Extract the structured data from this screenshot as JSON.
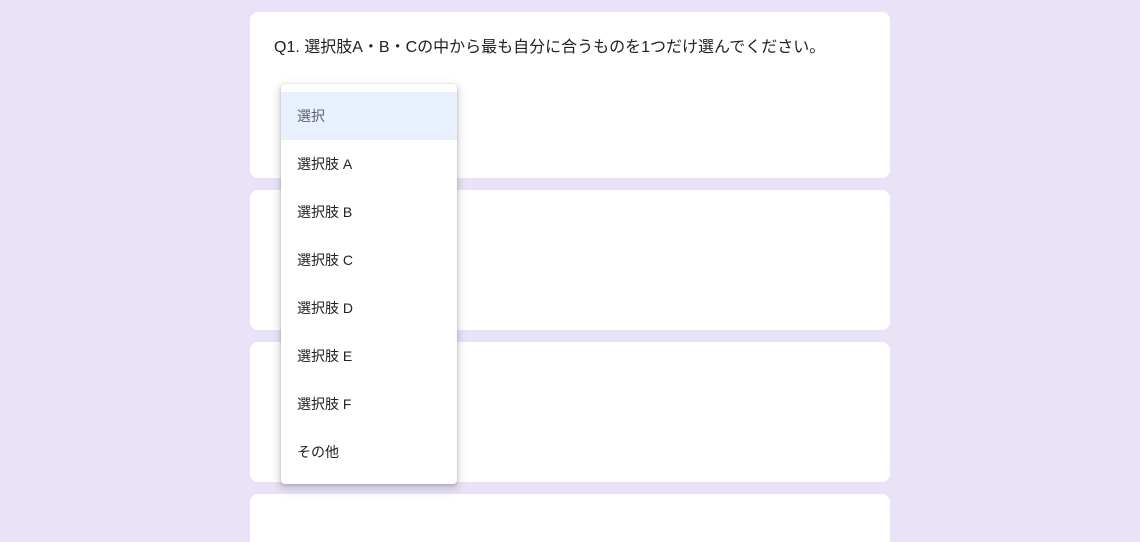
{
  "question": {
    "number": "Q1.",
    "text": "選択肢A・B・Cの中から最も自分に合うものを1つだけ選んでください。"
  },
  "dropdown": {
    "placeholder": "選択",
    "options": [
      "選択肢 A",
      "選択肢 B",
      "選択肢 C",
      "選択肢 D",
      "選択肢 E",
      "選択肢 F",
      "その他"
    ]
  }
}
